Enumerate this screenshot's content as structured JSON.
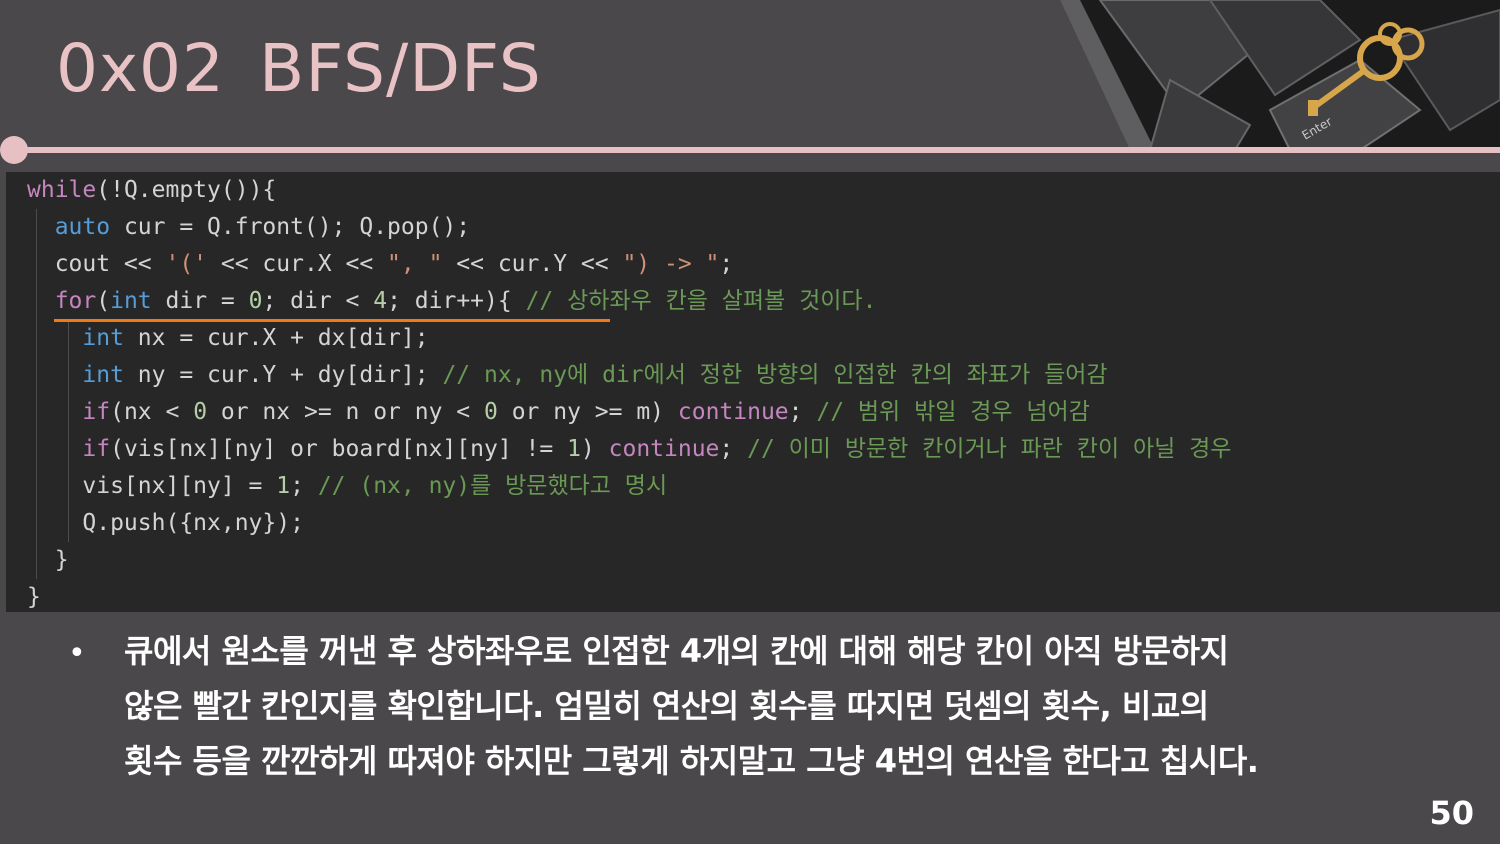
{
  "slide": {
    "title_code": "0x02",
    "title_text": "BFS/DFS",
    "page_number": "50",
    "bullet_lines": [
      "큐에서 원소를 꺼낸 후  상하좌우로 인접한 4개의 칸에 대해 해당 칸이 아직 방문하지",
      "않은 빨간 칸인지를 확인합니다. 엄밀히 연산의 횟수를 따지면 덧셈의 횟수, 비교의",
      "횟수 등을 깐깐하게 따져야 하지만 그렇게 하지말고 그냥 4번의 연산을 한다고 칩시다."
    ],
    "corner_image_label": "Enter"
  },
  "code": {
    "lines": [
      "while(!Q.empty()){",
      "  auto cur = Q.front(); Q.pop();",
      "  cout << '(' << cur.X << \", \" << cur.Y << \") -> \";",
      "  for(int dir = 0; dir < 4; dir++){ // 상하좌우 칸을 살펴볼 것이다.",
      "    int nx = cur.X + dx[dir];",
      "    int ny = cur.Y + dy[dir]; // nx, ny에 dir에서 정한 방향의 인접한 칸의 좌표가 들어감",
      "    if(nx < 0 or nx >= n or ny < 0 or ny >= m) continue; // 범위 밖일 경우 넘어감",
      "    if(vis[nx][ny] or board[nx][ny] != 1) continue; // 이미 방문한 칸이거나 파란 칸이 아닐 경우",
      "    vis[nx][ny] = 1; // (nx, ny)를 방문했다고 명시",
      "    Q.push({nx,ny});",
      "  }",
      "}"
    ]
  },
  "colors": {
    "background": "#4a484a",
    "title": "#e9c2c5",
    "divider": "#e7c0c3",
    "code_bg": "#272727",
    "keyword": "#c586c0",
    "type": "#569cd6",
    "comment": "#6a9955",
    "number": "#b5cea8",
    "string": "#ce9178",
    "highlight": "#f07a14"
  }
}
